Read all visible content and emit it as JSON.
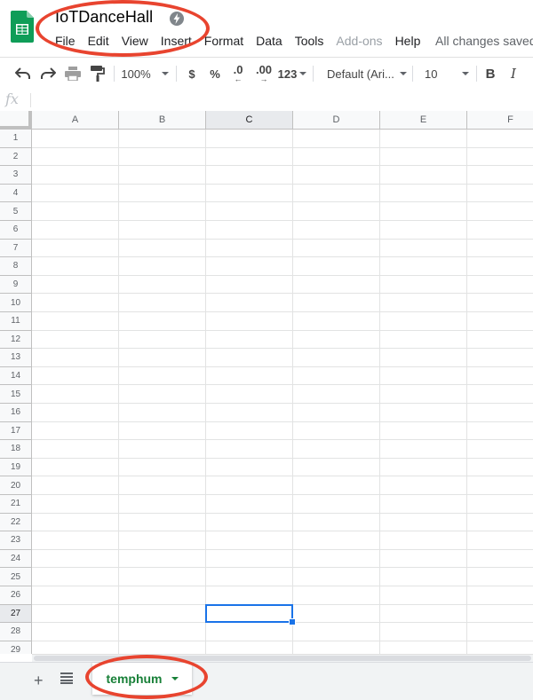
{
  "document": {
    "title": "IoTDanceHall",
    "save_status": "All changes saved"
  },
  "menu": [
    "File",
    "Edit",
    "View",
    "Insert",
    "Format",
    "Data",
    "Tools",
    "Add-ons",
    "Help"
  ],
  "menu_disabled_index": 7,
  "toolbar": {
    "zoom": "100%",
    "currency": "$",
    "percent": "%",
    "decrease_decimal": ".0",
    "increase_decimal": ".00",
    "more_formats": "123",
    "font": "Default (Ari...",
    "font_size": "10",
    "bold": "B",
    "italic": "I"
  },
  "formula_bar": {
    "fx_label": "fx",
    "value": ""
  },
  "grid": {
    "columns": [
      "A",
      "B",
      "C",
      "D",
      "E",
      "F"
    ],
    "rows": [
      "1",
      "2",
      "3",
      "4",
      "5",
      "6",
      "7",
      "8",
      "9",
      "10",
      "11",
      "12",
      "13",
      "14",
      "15",
      "16",
      "17",
      "18",
      "19",
      "20",
      "21",
      "22",
      "23",
      "24",
      "25",
      "26",
      "27",
      "28",
      "29"
    ],
    "selected_column_index": 2,
    "selected_row_index": 26
  },
  "sheets": [
    {
      "name": "temphum",
      "active": true
    }
  ],
  "colors": {
    "accent": "#1a73e8",
    "sheet_tab": "#188038",
    "annotation": "#e8442f",
    "logo": "#0f9d58"
  }
}
